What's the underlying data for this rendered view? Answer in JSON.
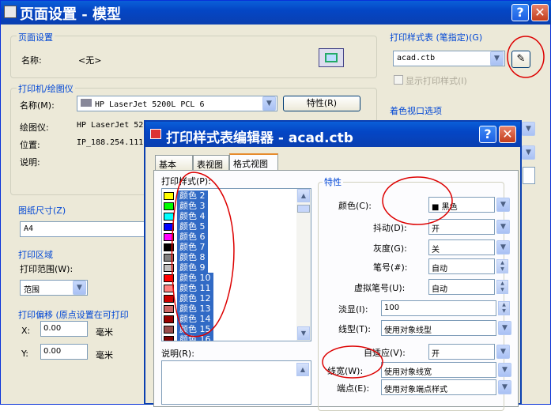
{
  "main": {
    "title": "页面设置 - 模型",
    "page_setup": {
      "group": "页面设置",
      "name_label": "名称:",
      "name_value": "<无>"
    },
    "printer": {
      "group": "打印机/绘图仪",
      "name_label": "名称(M):",
      "name_value": "HP LaserJet 5200L PCL 6",
      "props_button": "特性(R)",
      "plotter_label": "绘图仪:",
      "plotter_value": "HP LaserJet 52",
      "location_label": "位置:",
      "location_value": "IP_188.254.111",
      "desc_label": "说明:"
    },
    "paper": {
      "group": "图纸尺寸(Z)",
      "value": "A4"
    },
    "area": {
      "group": "打印区域",
      "range_label": "打印范围(W):",
      "range_value": "范围"
    },
    "offset": {
      "group": "打印偏移 (原点设置在可打印",
      "x_label": "X:",
      "x_value": "0.00",
      "x_unit": "毫米",
      "y_label": "Y:",
      "y_value": "0.00",
      "y_unit": "毫米"
    },
    "style_table": {
      "group": "打印样式表 (笔指定)(G)",
      "value": "acad.ctb",
      "show_styles": "显示打印样式(I)"
    },
    "shaded": {
      "group": "着色视口选项"
    }
  },
  "dialog": {
    "title": "打印样式表编辑器 - acad.ctb",
    "tabs": [
      "基本",
      "表视图",
      "格式视图"
    ],
    "styles_label": "打印样式(P):",
    "styles": [
      {
        "name": "颜色 2",
        "color": "#ffff00"
      },
      {
        "name": "颜色 3",
        "color": "#00ff00"
      },
      {
        "name": "颜色 4",
        "color": "#00ffff"
      },
      {
        "name": "颜色 5",
        "color": "#0000ff"
      },
      {
        "name": "颜色 6",
        "color": "#ff00ff"
      },
      {
        "name": "颜色 7",
        "color": "#000000"
      },
      {
        "name": "颜色 8",
        "color": "#808080"
      },
      {
        "name": "颜色 9",
        "color": "#c0c0c0"
      },
      {
        "name": "颜色 10",
        "color": "#ff0000"
      },
      {
        "name": "颜色 11",
        "color": "#ff7f7f"
      },
      {
        "name": "颜色 12",
        "color": "#cc0000"
      },
      {
        "name": "颜色 13",
        "color": "#cc6666"
      },
      {
        "name": "颜色 14",
        "color": "#990000"
      },
      {
        "name": "颜色 15",
        "color": "#994c4c"
      },
      {
        "name": "颜色 16",
        "color": "#7f0000"
      }
    ],
    "desc_label": "说明(R):",
    "props": {
      "group": "特性",
      "color_label": "颜色(C):",
      "color_value": "■ 黑色",
      "dither_label": "抖动(D):",
      "dither_value": "开",
      "gray_label": "灰度(G):",
      "gray_value": "关",
      "pen_label": "笔号(#):",
      "pen_value": "自动",
      "vpen_label": "虚拟笔号(U):",
      "vpen_value": "自动",
      "screen_label": "淡显(I):",
      "screen_value": "100",
      "ltype_label": "线型(T):",
      "ltype_value": "使用对象线型",
      "adapt_label": "自适应(V):",
      "adapt_value": "开",
      "lweight_label": "线宽(W):",
      "lweight_value": "使用对象线宽",
      "endstyle_label": "端点(E):",
      "endstyle_value": "使用对象端点样式"
    }
  }
}
